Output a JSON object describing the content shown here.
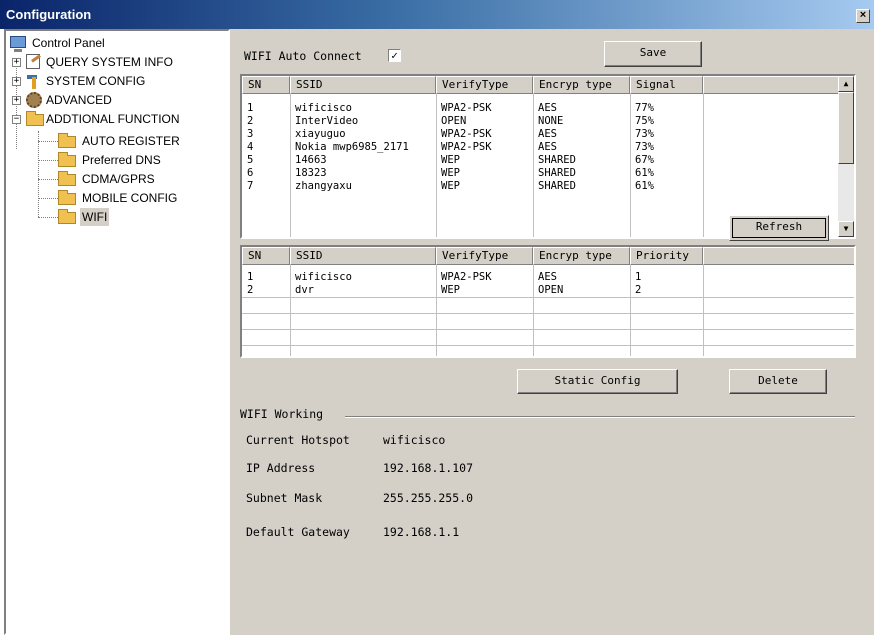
{
  "window": {
    "title": "Configuration",
    "close_glyph": "×"
  },
  "tree": {
    "root": "Control Panel",
    "items": [
      {
        "label": "QUERY SYSTEM INFO",
        "icon": "document-icon"
      },
      {
        "label": "SYSTEM CONFIG",
        "icon": "tools-icon"
      },
      {
        "label": "ADVANCED",
        "icon": "gear-icon"
      },
      {
        "label": "ADDTIONAL FUNCTION",
        "icon": "folder-icon"
      }
    ],
    "children": [
      "AUTO REGISTER",
      "Preferred DNS",
      "CDMA/GPRS",
      "MOBILE CONFIG",
      "WIFI"
    ],
    "expand_plus": "+",
    "expand_minus": "−"
  },
  "wifi": {
    "auto_connect_label": "WIFI Auto Connect",
    "auto_connect_checked": "✓",
    "save_label": "Save",
    "refresh_label": "Refresh",
    "static_config_label": "Static Config",
    "delete_label": "Delete",
    "scan_table": {
      "headers": [
        "SN",
        "SSID",
        "VerifyType",
        "Encryp type",
        "Signal"
      ],
      "rows": [
        [
          "1",
          "wificisco",
          "WPA2-PSK",
          "AES",
          "77%"
        ],
        [
          "2",
          "InterVideo",
          "OPEN",
          "NONE",
          "75%"
        ],
        [
          "3",
          "xiayuguo",
          "WPA2-PSK",
          "AES",
          "73%"
        ],
        [
          "4",
          "Nokia mwp6985_2171",
          "WPA2-PSK",
          "AES",
          "73%"
        ],
        [
          "5",
          "14663",
          "WEP",
          "SHARED",
          "67%"
        ],
        [
          "6",
          "18323",
          "WEP",
          "SHARED",
          "61%"
        ],
        [
          "7",
          "zhangyaxu",
          "WEP",
          "SHARED",
          "61%"
        ]
      ]
    },
    "saved_table": {
      "headers": [
        "SN",
        "SSID",
        "VerifyType",
        "Encryp type",
        "Priority"
      ],
      "rows": [
        [
          "1",
          "wificisco",
          "WPA2-PSK",
          "AES",
          "1"
        ],
        [
          "2",
          "dvr",
          "WEP",
          "OPEN",
          "2"
        ]
      ]
    },
    "working": {
      "group_label": "WIFI Working",
      "current_hotspot_label": "Current Hotspot",
      "current_hotspot": "wificisco",
      "ip_label": "IP Address",
      "ip": "192.168.1.107",
      "subnet_label": "Subnet Mask",
      "subnet": "255.255.255.0",
      "gateway_label": "Default Gateway",
      "gateway": "192.168.1.1"
    },
    "scroll_up": "▲",
    "scroll_down": "▼"
  }
}
